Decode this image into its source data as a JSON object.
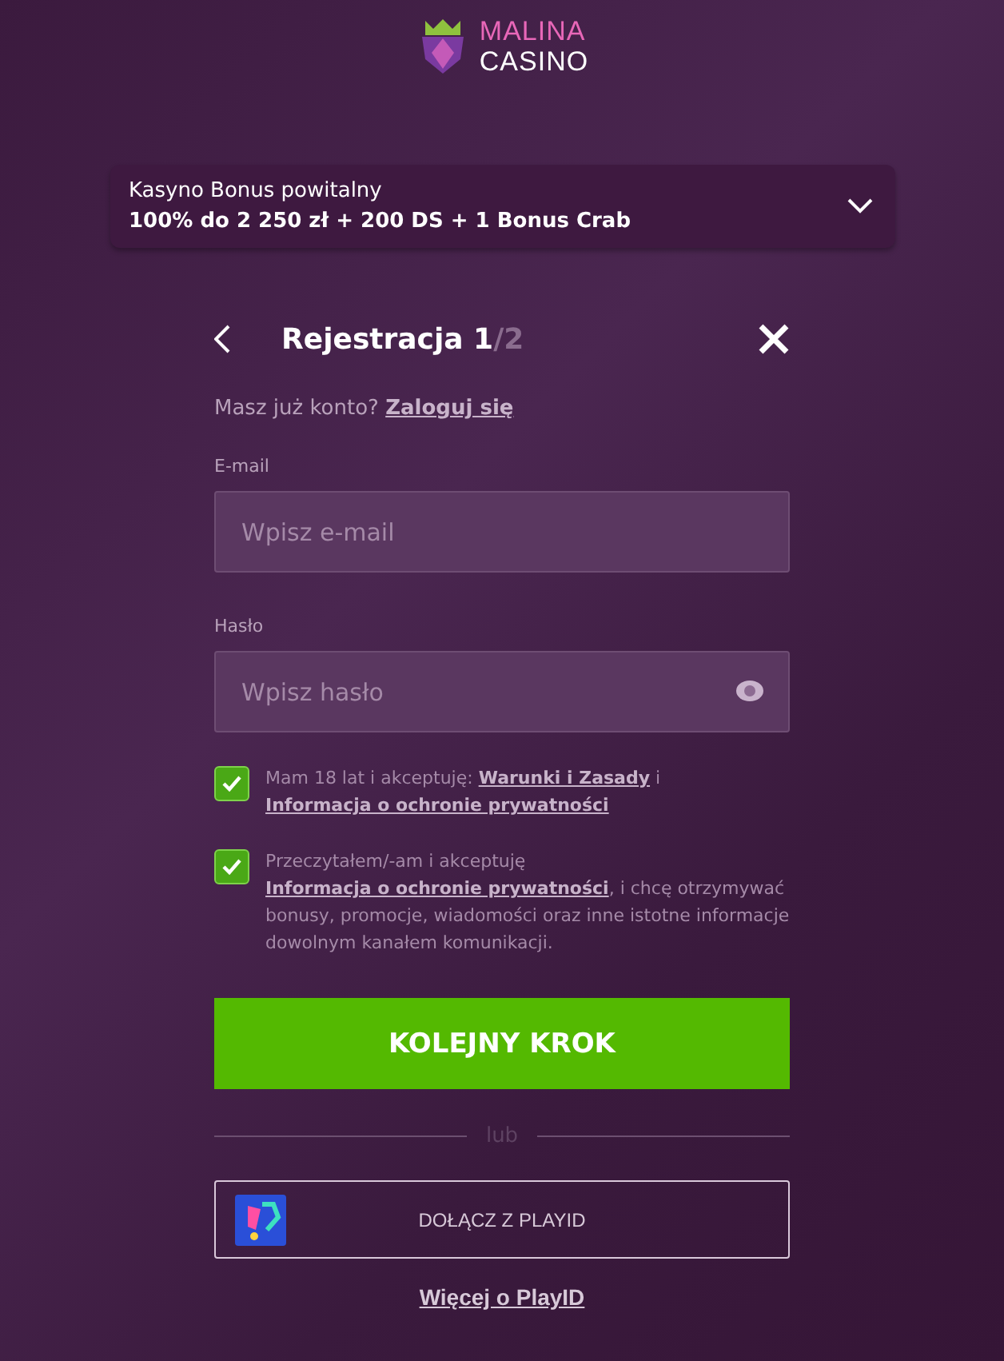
{
  "logo": {
    "line_1": "MALINA",
    "line_2": "CASINO"
  },
  "bonus": {
    "title": "Kasyno Bonus powitalny",
    "offer": "100% do 2 250 zł + 200 DS + 1 Bonus Crab",
    "expanded": false
  },
  "form": {
    "title": "Rejestracja 1",
    "step_total": "/2",
    "login_prompt": "Masz już konto?",
    "login_link": "Zaloguj się",
    "fields": [
      {
        "label": "E-mail",
        "placeholder": "Wpisz e-mail",
        "kind": "email"
      },
      {
        "label": "Hasło",
        "placeholder": "Wpisz hasło",
        "kind": "password"
      }
    ],
    "consents": [
      {
        "checked": true,
        "parts": [
          {
            "kind": "text",
            "text": "Mam 18 lat i akceptuję: "
          },
          {
            "kind": "link",
            "text": "Warunki i Zasady"
          },
          {
            "kind": "text",
            "text": " i "
          },
          {
            "kind": "link",
            "text": "Informacja o ochronie prywatności"
          }
        ]
      },
      {
        "checked": true,
        "parts": [
          {
            "kind": "text",
            "text": "Przeczytałem/-am i akceptuję "
          },
          {
            "kind": "link",
            "text": "Informacja o ochronie prywatności"
          },
          {
            "kind": "text",
            "text": ", i chcę otrzymywać bonusy, promocje, wiadomości oraz inne istotne informacje dowolnym kanałem komunikacji."
          }
        ]
      }
    ],
    "submit": "KOLEJNY KROK",
    "divider": "lub",
    "playid_button": "DOŁĄCZ Z PLAYID",
    "playid_link": "Więcej o PlayID"
  }
}
